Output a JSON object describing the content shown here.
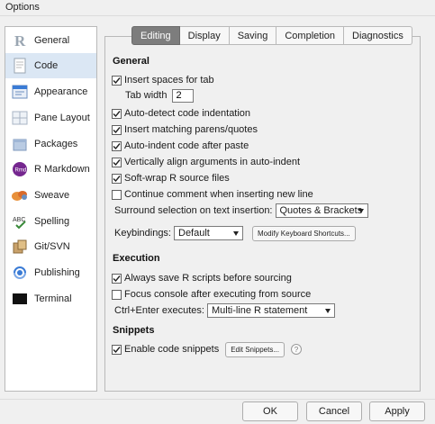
{
  "window": {
    "title": "Options"
  },
  "sidebar": {
    "items": [
      {
        "label": "General",
        "icon": "r-logo-icon"
      },
      {
        "label": "Code",
        "icon": "code-page-icon"
      },
      {
        "label": "Appearance",
        "icon": "appearance-icon"
      },
      {
        "label": "Pane Layout",
        "icon": "pane-layout-icon"
      },
      {
        "label": "Packages",
        "icon": "packages-icon"
      },
      {
        "label": "R Markdown",
        "icon": "rmarkdown-icon"
      },
      {
        "label": "Sweave",
        "icon": "sweave-icon"
      },
      {
        "label": "Spelling",
        "icon": "spelling-icon"
      },
      {
        "label": "Git/SVN",
        "icon": "git-icon"
      },
      {
        "label": "Publishing",
        "icon": "publishing-icon"
      },
      {
        "label": "Terminal",
        "icon": "terminal-icon"
      }
    ],
    "selected": "Code"
  },
  "tabs": [
    "Editing",
    "Display",
    "Saving",
    "Completion",
    "Diagnostics"
  ],
  "active_tab": "Editing",
  "general": {
    "title": "General",
    "insert_spaces": "Insert spaces for tab",
    "tab_width_label": "Tab width",
    "tab_width_value": "2",
    "auto_detect": "Auto-detect code indentation",
    "insert_matching": "Insert matching parens/quotes",
    "auto_indent": "Auto-indent code after paste",
    "vertical_align": "Vertically align arguments in auto-indent",
    "soft_wrap": "Soft-wrap R source files",
    "continue_comment": "Continue comment when inserting new line",
    "surround_label": "Surround selection on text insertion:",
    "surround_value": "Quotes & Brackets",
    "keybindings_label": "Keybindings:",
    "keybindings_value": "Default",
    "modify_shortcuts": "Modify Keyboard Shortcuts..."
  },
  "execution": {
    "title": "Execution",
    "always_save": "Always save R scripts before sourcing",
    "focus_console": "Focus console after executing from source",
    "ctrl_enter_label": "Ctrl+Enter executes:",
    "ctrl_enter_value": "Multi-line R statement"
  },
  "snippets": {
    "title": "Snippets",
    "enable": "Enable code snippets",
    "edit_button": "Edit Snippets...",
    "help_glyph": "?"
  },
  "buttons": {
    "ok": "OK",
    "cancel": "Cancel",
    "apply": "Apply"
  },
  "colors": {
    "active_tab_bg": "#7d7d7d",
    "selected_sidebar_bg": "#dbe7f4",
    "rmarkdown_purple": "#75278f",
    "publishing_blue": "#3a7bd5"
  }
}
